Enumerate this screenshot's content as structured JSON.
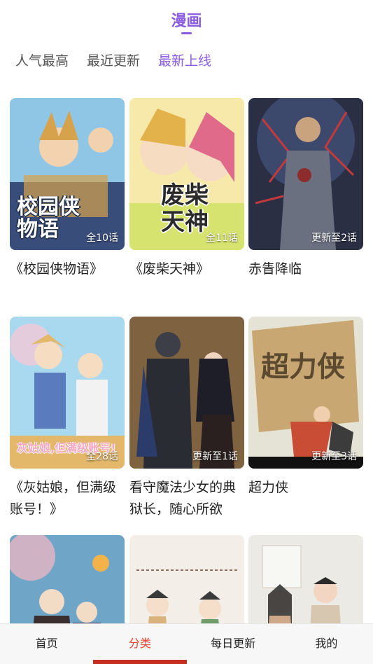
{
  "header": {
    "title": "漫画"
  },
  "sort_tabs": [
    {
      "label": "人气最高",
      "active": false
    },
    {
      "label": "最近更新",
      "active": false
    },
    {
      "label": "最新上线",
      "active": true
    }
  ],
  "comics": [
    {
      "title": "《校园侠物语》",
      "badge": "全10话",
      "cover_text": "校园侠\n物语",
      "palette": [
        "#8fc6e6",
        "#d7a24c",
        "#394d7a"
      ]
    },
    {
      "title": "《废柴天神》",
      "badge": "全11话",
      "cover_text": "废柴\n天神",
      "palette": [
        "#f7e9a9",
        "#d7e36f",
        "#e06a8a"
      ]
    },
    {
      "title": "赤眚降临",
      "badge": "更新至2话",
      "cover_text": "",
      "palette": [
        "#4b5a88",
        "#8c2c2c",
        "#2a2f44"
      ]
    },
    {
      "title": "《灰姑娘，但满级账号！》",
      "badge": "全28话",
      "cover_text": "灰姑娘,但满级账号!",
      "palette": [
        "#a8d9ef",
        "#e3b86b",
        "#5b7bbf"
      ]
    },
    {
      "title": "看守魔法少女的典狱长，随心所欲",
      "badge": "更新至1话",
      "cover_text": "",
      "palette": [
        "#4a3a2a",
        "#b38a53",
        "#1e1e28"
      ]
    },
    {
      "title": "超力侠",
      "badge": "更新至3话",
      "cover_text": "超力侠",
      "palette": [
        "#e5e2d6",
        "#c8a772",
        "#c94c35"
      ]
    },
    {
      "title": "",
      "badge": "",
      "cover_text": "",
      "palette": [
        "#6fa6c8",
        "#e7b7c3",
        "#3a2e2e"
      ]
    },
    {
      "title": "",
      "badge": "",
      "cover_text": "",
      "palette": [
        "#f3efe8",
        "#d9b27c",
        "#3a3a3a"
      ]
    },
    {
      "title": "",
      "badge": "",
      "cover_text": "",
      "palette": [
        "#eceae4",
        "#cda98a",
        "#2b2b2b"
      ]
    }
  ],
  "tabbar": [
    {
      "label": "首页",
      "active": false
    },
    {
      "label": "分类",
      "active": true
    },
    {
      "label": "每日更新",
      "active": false
    },
    {
      "label": "我的",
      "active": false
    }
  ],
  "colors": {
    "accent": "#8a5ce0",
    "tab_active": "#e2402e"
  }
}
